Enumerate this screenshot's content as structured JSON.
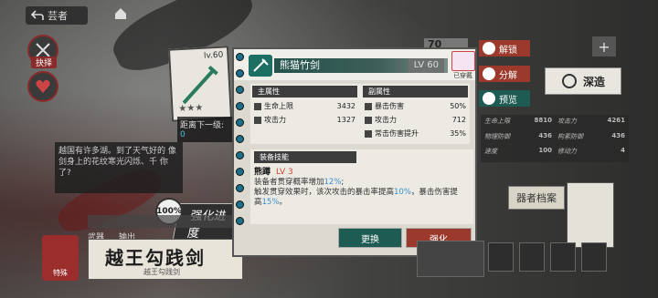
{
  "topbar": {
    "back_label": "芸者"
  },
  "sidebar": {
    "items": [
      {
        "label": "抉择"
      },
      {
        "label": ""
      }
    ]
  },
  "story": {
    "text": "越国有许多湖。到了天气好的 像剑身上的花纹寒光闪烁、千 你了?"
  },
  "card": {
    "level": "lv.60",
    "stars": "★★★"
  },
  "distance": {
    "label": "距离下一级:",
    "value": "0"
  },
  "progress": {
    "percent": "100%",
    "label": "强化进度"
  },
  "weapon_plate": {
    "name": "越王勾践剑",
    "subtitle": "越王勾践剑",
    "tabs": [
      "武器",
      "输出"
    ],
    "seal_label": "特殊"
  },
  "panel": {
    "title": "熊猫竹剑",
    "level": "LV 60",
    "equipped_label": "已穿戴",
    "main_stats_header": "主属性",
    "sub_stats_header": "副属性",
    "main_stats": [
      {
        "name": "生命上限",
        "value": "3432"
      },
      {
        "name": "攻击力",
        "value": "1327"
      }
    ],
    "sub_stats": [
      {
        "name": "暴击伤害",
        "value": "50%"
      },
      {
        "name": "攻击力",
        "value": "712"
      },
      {
        "name": "常击伤害提升",
        "value": "35%"
      }
    ],
    "skill_header": "装备技能",
    "skill_name": "熊蹲",
    "skill_level": "LV 3",
    "skill_desc_1a": "装备者贯穿概率增加",
    "skill_desc_1b": "12%",
    "skill_desc_1c": ";",
    "skill_desc_2a": "触发贯穿效果时，该次攻击的暴击率提高",
    "skill_desc_2b": "10%",
    "skill_desc_2c": "，暴击伤害提",
    "skill_desc_3a": "高",
    "skill_desc_3b": "15%",
    "skill_desc_3c": "。",
    "btn_swap": "更换",
    "btn_enhance": "强化"
  },
  "actions": [
    {
      "label": "解锁",
      "color": "#9b3a2c"
    },
    {
      "label": "分解",
      "color": "#9b3a2c"
    },
    {
      "label": "预览",
      "color": "#1e5b52"
    }
  ],
  "right": {
    "count": "70",
    "deep_label": "深造",
    "files_label": "器者档案",
    "stats": [
      {
        "name": "生命上限",
        "value": "8810"
      },
      {
        "name": "攻击力",
        "value": "4261"
      },
      {
        "name": "物理防御",
        "value": "436"
      },
      {
        "name": "构素防御",
        "value": "436"
      },
      {
        "name": "速度",
        "value": "100"
      },
      {
        "name": "修动力",
        "value": "4"
      }
    ]
  }
}
